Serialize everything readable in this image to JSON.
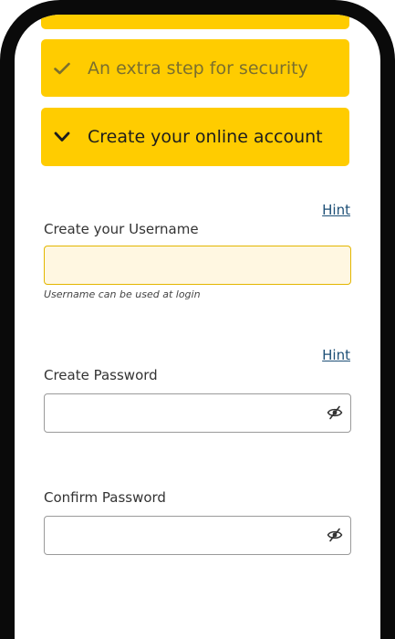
{
  "steps": {
    "security": {
      "label": "An extra step for security",
      "icon": "check-icon"
    },
    "create": {
      "label": "Create your online account",
      "icon": "chevron-down-icon"
    }
  },
  "form": {
    "username": {
      "hint": "Hint",
      "label": "Create your Username",
      "value": "",
      "help": "Username can be used at login"
    },
    "password": {
      "hint": "Hint",
      "label": "Create Password",
      "value": "",
      "icon": "eye-slash-icon"
    },
    "confirm": {
      "label": "Confirm Password",
      "value": "",
      "icon": "eye-slash-icon"
    }
  },
  "colors": {
    "accent": "#ffcc00",
    "focus_background": "#fff7e1",
    "link": "#1d4f76"
  }
}
